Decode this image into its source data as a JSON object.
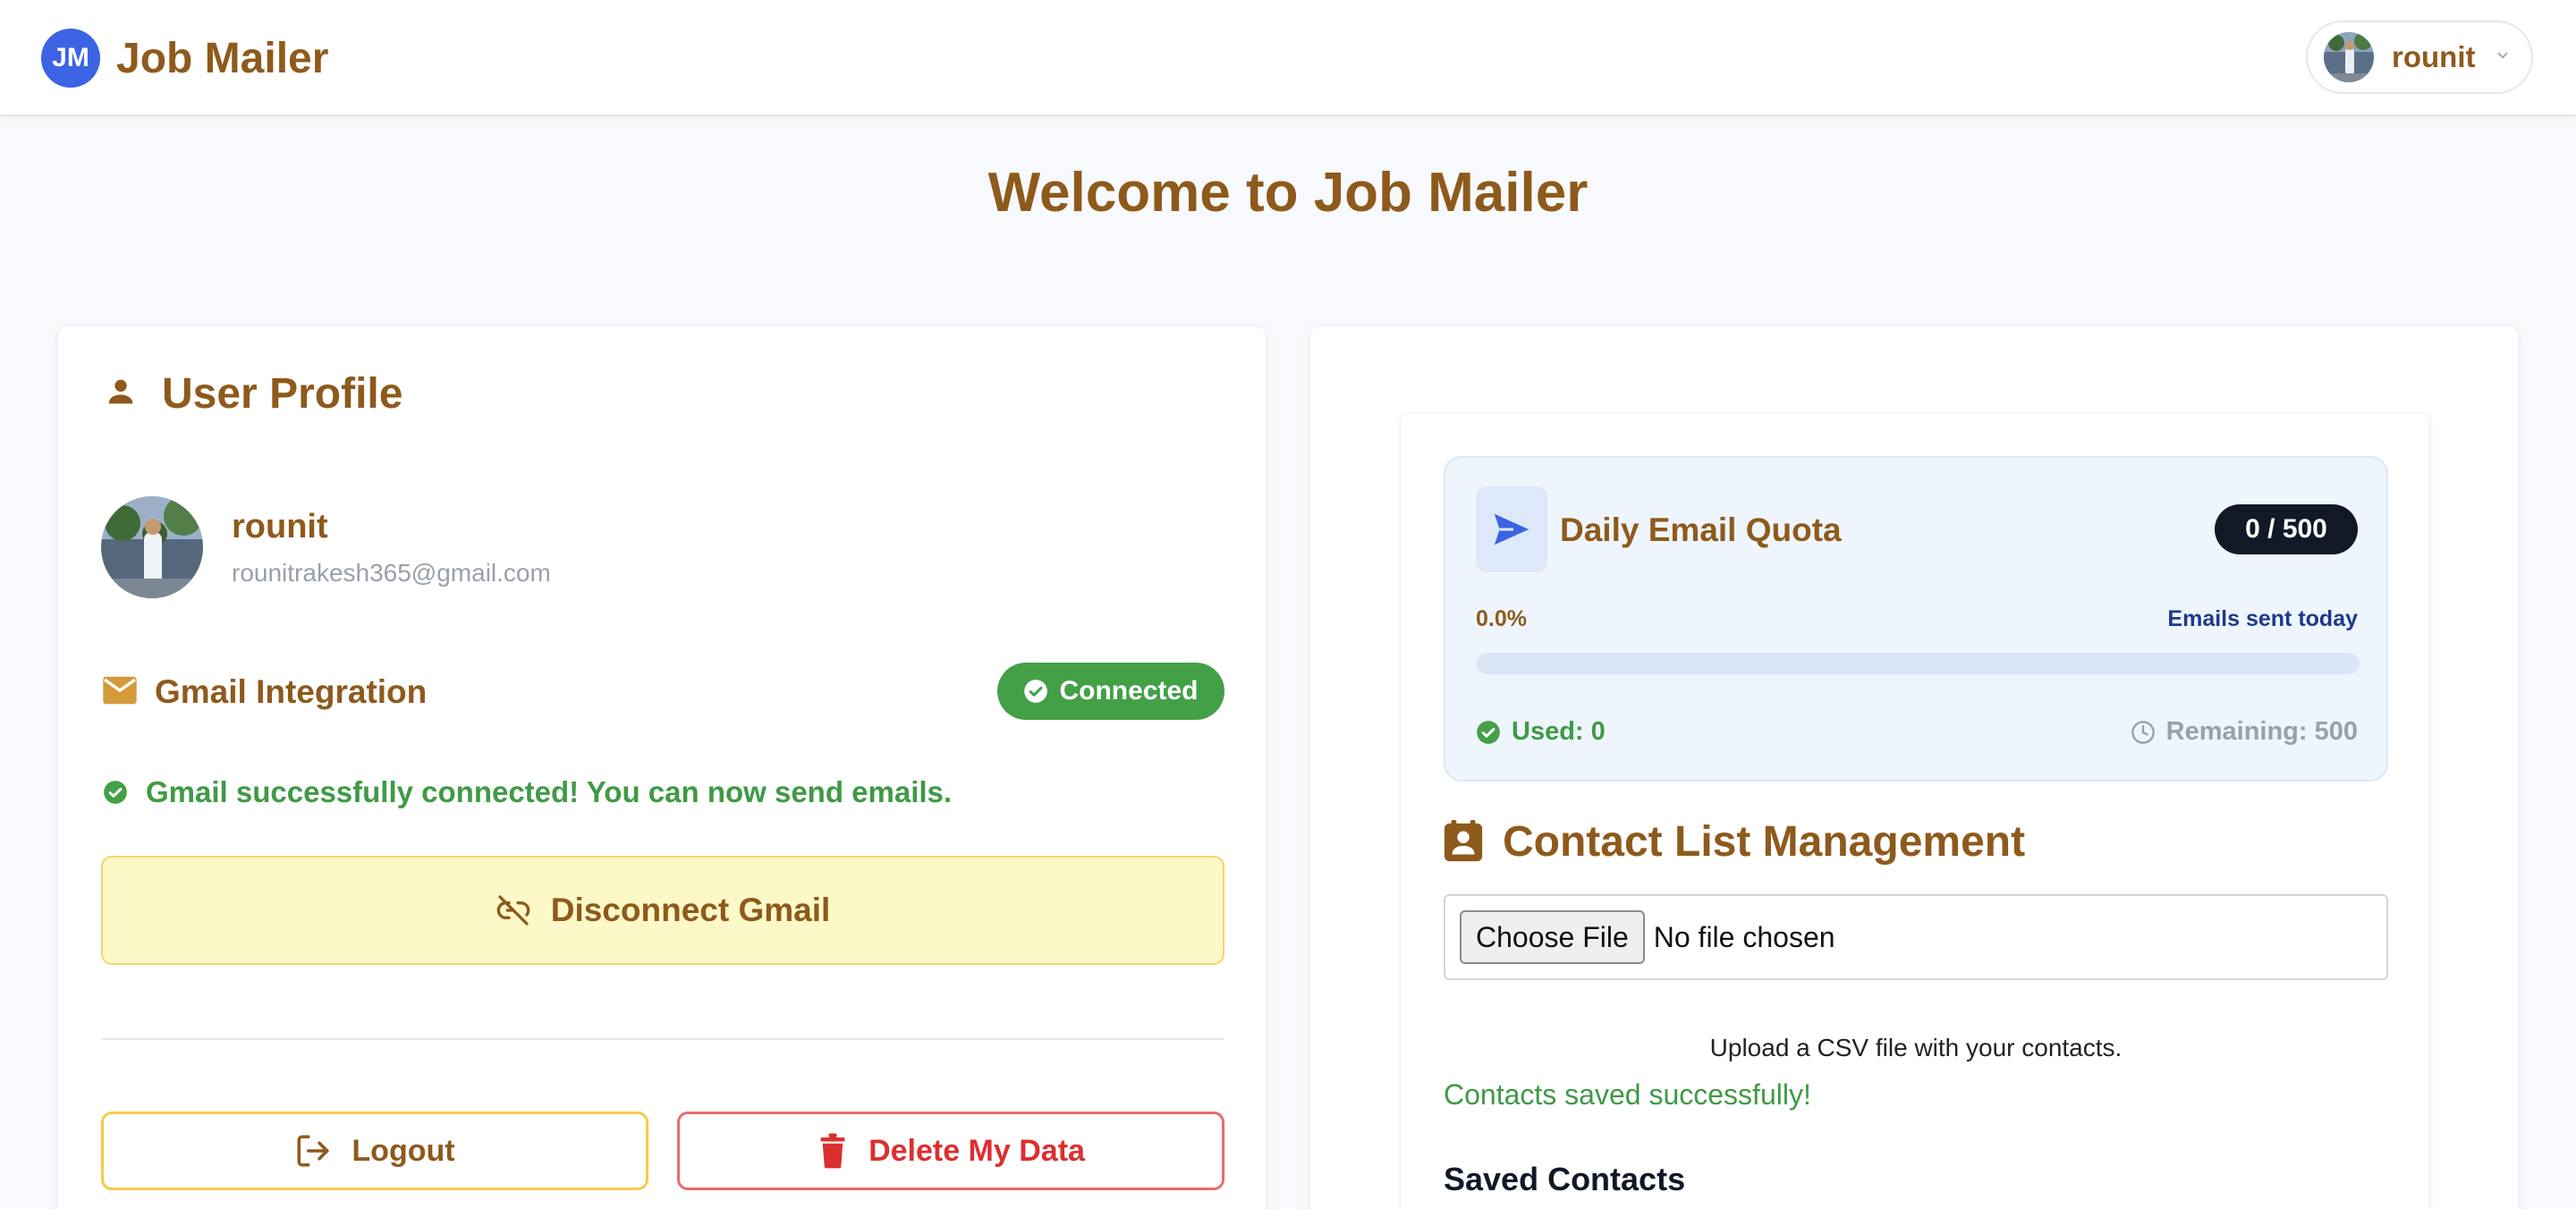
{
  "header": {
    "logo_initials": "JM",
    "app_name": "Job Mailer",
    "user_name": "rounit"
  },
  "page": {
    "title": "Welcome to Job Mailer"
  },
  "profile_card": {
    "section_title": "User Profile",
    "user_name": "rounit",
    "user_email": "rounitrakesh365@gmail.com",
    "gmail_title": "Gmail Integration",
    "connected_badge": "Connected",
    "success_message": "Gmail successfully connected! You can now send emails.",
    "disconnect_label": "Disconnect Gmail",
    "logout_label": "Logout",
    "delete_label": "Delete My Data"
  },
  "quota": {
    "title": "Daily Email Quota",
    "pill": "0 / 500",
    "percent_text": "0.0%",
    "progress_fraction": 0.0,
    "label": "Emails sent today",
    "used": "Used: 0",
    "remaining": "Remaining: 500"
  },
  "contacts": {
    "title": "Contact List Management",
    "choose_file": "Choose File",
    "file_status": "No file chosen",
    "upload_hint": "Upload a CSV file with your contacts.",
    "saved_message": "Contacts saved successfully!",
    "saved_heading": "Saved Contacts"
  },
  "colors": {
    "brand_brown": "#8e5a1c",
    "accent_blue": "#3b63e3",
    "success_green": "#43a047",
    "danger_red": "#dc2f2f",
    "warning_yellow": "#f2cc48"
  }
}
